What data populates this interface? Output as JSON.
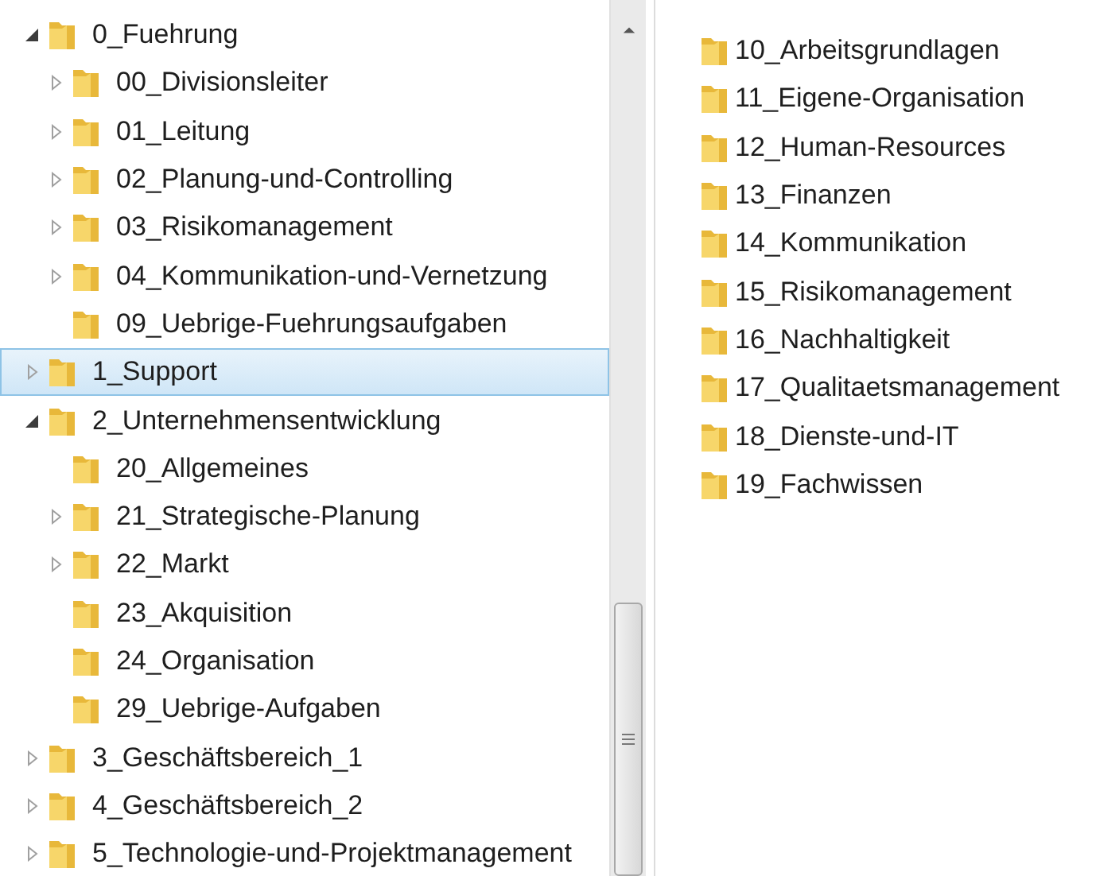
{
  "tree": [
    {
      "label": "0_Fuehrung",
      "expanded": true,
      "selected": false,
      "children": [
        {
          "label": "00_Divisionsleiter",
          "expanded": false,
          "selected": false
        },
        {
          "label": "01_Leitung",
          "expanded": false,
          "selected": false
        },
        {
          "label": "02_Planung-und-Controlling",
          "expanded": false,
          "selected": false
        },
        {
          "label": "03_Risikomanagement",
          "expanded": false,
          "selected": false
        },
        {
          "label": "04_Kommunikation-und-Vernetzung",
          "expanded": false,
          "selected": false
        },
        {
          "label": "09_Uebrige-Fuehrungsaufgaben",
          "selected": false
        }
      ]
    },
    {
      "label": "1_Support",
      "expanded": false,
      "selected": true
    },
    {
      "label": "2_Unternehmensentwicklung",
      "expanded": true,
      "selected": false,
      "children": [
        {
          "label": "20_Allgemeines",
          "selected": false
        },
        {
          "label": "21_Strategische-Planung",
          "expanded": false,
          "selected": false
        },
        {
          "label": "22_Markt",
          "expanded": false,
          "selected": false
        },
        {
          "label": "23_Akquisition",
          "selected": false
        },
        {
          "label": "24_Organisation",
          "selected": false
        },
        {
          "label": "29_Uebrige-Aufgaben",
          "selected": false
        }
      ]
    },
    {
      "label": "3_Geschäftsbereich_1",
      "expanded": false,
      "selected": false
    },
    {
      "label": "4_Geschäftsbereich_2",
      "expanded": false,
      "selected": false
    },
    {
      "label": "5_Technologie-und-Projektmanagement",
      "expanded": false,
      "selected": false
    }
  ],
  "contents": [
    {
      "label": "10_Arbeitsgrundlagen"
    },
    {
      "label": "11_Eigene-Organisation"
    },
    {
      "label": "12_Human-Resources"
    },
    {
      "label": "13_Finanzen"
    },
    {
      "label": "14_Kommunikation"
    },
    {
      "label": "15_Risikomanagement"
    },
    {
      "label": "16_Nachhaltigkeit"
    },
    {
      "label": "17_Qualitaetsmanagement"
    },
    {
      "label": "18_Dienste-und-IT"
    },
    {
      "label": "19_Fachwissen"
    }
  ]
}
